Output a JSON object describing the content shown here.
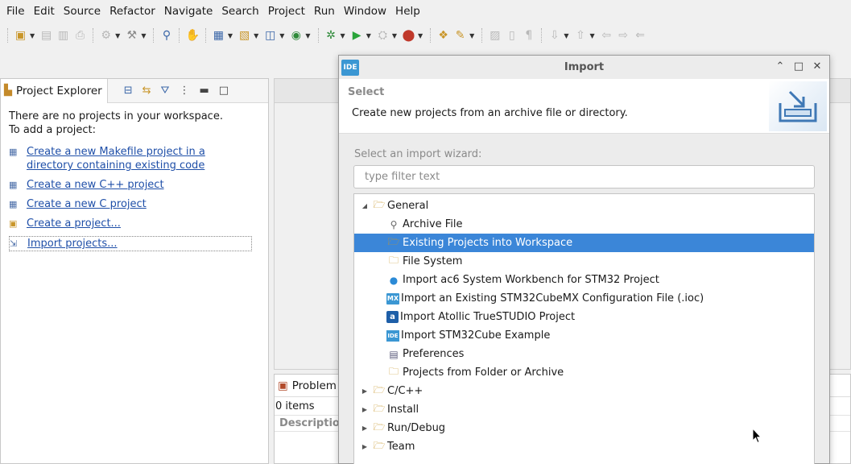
{
  "menubar": {
    "items": [
      "File",
      "Edit",
      "Source",
      "Refactor",
      "Navigate",
      "Search",
      "Project",
      "Run",
      "Window",
      "Help"
    ]
  },
  "toolbar": {
    "icons": [
      "new-icon",
      "save-icon",
      "save-all-icon",
      "print-icon",
      "build-icon",
      "hammer-icon",
      "link-icon",
      "hand-icon",
      "new-cpp-project-icon",
      "new-folder-icon",
      "new-class-icon",
      "new-source-icon",
      "debug-icon",
      "run-icon",
      "external-tools-icon",
      "stop-icon",
      "open-type-icon",
      "search-icon",
      "annotations-icon",
      "pin-icon",
      "pilcrow-icon",
      "next-annotation-icon",
      "prev-annotation-icon",
      "back-icon",
      "forward-icon"
    ]
  },
  "explorer": {
    "tab_label": "Project Explorer",
    "message_line1": "There are no projects in your workspace.",
    "message_line2": "To add a project:",
    "links": [
      {
        "text": "Create a new Makefile project in a directory containing existing code",
        "line1": "Create a new Makefile project in a ",
        "line2": "directory containing existing code"
      },
      {
        "text": "Create a new C++ project"
      },
      {
        "text": "Create a new C project"
      },
      {
        "text": "Create a project..."
      },
      {
        "text": "Import projects..."
      }
    ]
  },
  "problems": {
    "tab_label": "Problem",
    "count": "0 items",
    "column": "Descriptio"
  },
  "dialog": {
    "logo": "IDE",
    "title": "Import",
    "header_title": "Select",
    "header_desc": "Create new projects from an archive file or directory.",
    "wizard_label": "Select an import wizard:",
    "filter_placeholder": "type filter text",
    "tree": [
      {
        "label": "General",
        "expanded": true,
        "children": [
          {
            "label": "Archive File",
            "icon": "archive-file-icon"
          },
          {
            "label": "Existing Projects into Workspace",
            "icon": "existing-projects-icon",
            "selected": true
          },
          {
            "label": "File System",
            "icon": "folder-icon"
          },
          {
            "label": "Import ac6 System Workbench for STM32 Project",
            "icon": "ac6-icon"
          },
          {
            "label": "Import an Existing STM32CubeMX Configuration File (.ioc)",
            "icon": "cubemx-icon"
          },
          {
            "label": "Import Atollic TrueSTUDIO Project",
            "icon": "atollic-icon"
          },
          {
            "label": "Import STM32Cube Example",
            "icon": "ide-icon"
          },
          {
            "label": "Preferences",
            "icon": "preferences-icon"
          },
          {
            "label": "Projects from Folder or Archive",
            "icon": "folder-icon"
          }
        ]
      },
      {
        "label": "C/C++",
        "expanded": false
      },
      {
        "label": "Install",
        "expanded": false
      },
      {
        "label": "Run/Debug",
        "expanded": false
      },
      {
        "label": "Team",
        "expanded": false
      }
    ]
  },
  "colors": {
    "selection": "#3b86d8",
    "link": "#1f4fa8",
    "ide_blue": "#3b97d3"
  }
}
